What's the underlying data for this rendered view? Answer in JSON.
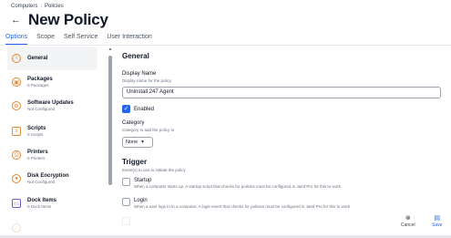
{
  "breadcrumb": {
    "root": "Computers",
    "separator": ":",
    "current": "Policies"
  },
  "page": {
    "back_icon": "arrow-left-icon",
    "title": "New Policy"
  },
  "tabs": [
    {
      "label": "Options",
      "active": true
    },
    {
      "label": "Scope",
      "active": false
    },
    {
      "label": "Self Service",
      "active": false
    },
    {
      "label": "User Interaction",
      "active": false
    }
  ],
  "sidebar": {
    "items": [
      {
        "label": "General",
        "sub": "",
        "icon": "info-icon",
        "active": true
      },
      {
        "label": "Packages",
        "sub": "0 Packages",
        "icon": "package-icon",
        "active": false
      },
      {
        "label": "Software Updates",
        "sub": "Not Configured",
        "icon": "gear-icon",
        "active": false
      },
      {
        "label": "Scripts",
        "sub": "0 Scripts",
        "icon": "script-icon",
        "active": false
      },
      {
        "label": "Printers",
        "sub": "0 Printers",
        "icon": "printer-icon",
        "active": false
      },
      {
        "label": "Disk Encryption",
        "sub": "Not Configured",
        "icon": "lock-icon",
        "active": false
      },
      {
        "label": "Dock Items",
        "sub": "0 Dock Items",
        "icon": "dock-icon",
        "active": false
      }
    ]
  },
  "general": {
    "title": "General",
    "display_name_label": "Display Name",
    "display_name_help": "Display name for the policy",
    "display_name_value": "Uninstall 247 Agent",
    "enabled_label": "Enabled",
    "enabled_checked": true,
    "category_label": "Category",
    "category_help": "Category to add the policy to",
    "category_value": "None"
  },
  "trigger": {
    "title": "Trigger",
    "help": "Event(s) to use to initiate the policy",
    "items": [
      {
        "label": "Startup",
        "desc": "When a computer starts up. A startup script that checks for policies must be configured in Jamf Pro for this to work",
        "checked": false
      },
      {
        "label": "Login",
        "desc": "When a user logs in to a computer. A login event that checks for policies must be configured in Jamf Pro for this to work",
        "checked": false
      }
    ]
  },
  "actions": {
    "cancel_label": "Cancel",
    "save_label": "Save"
  },
  "colors": {
    "accent": "#2563eb",
    "icon_orange": "#e2852b",
    "icon_purple": "#6d5bd0"
  }
}
